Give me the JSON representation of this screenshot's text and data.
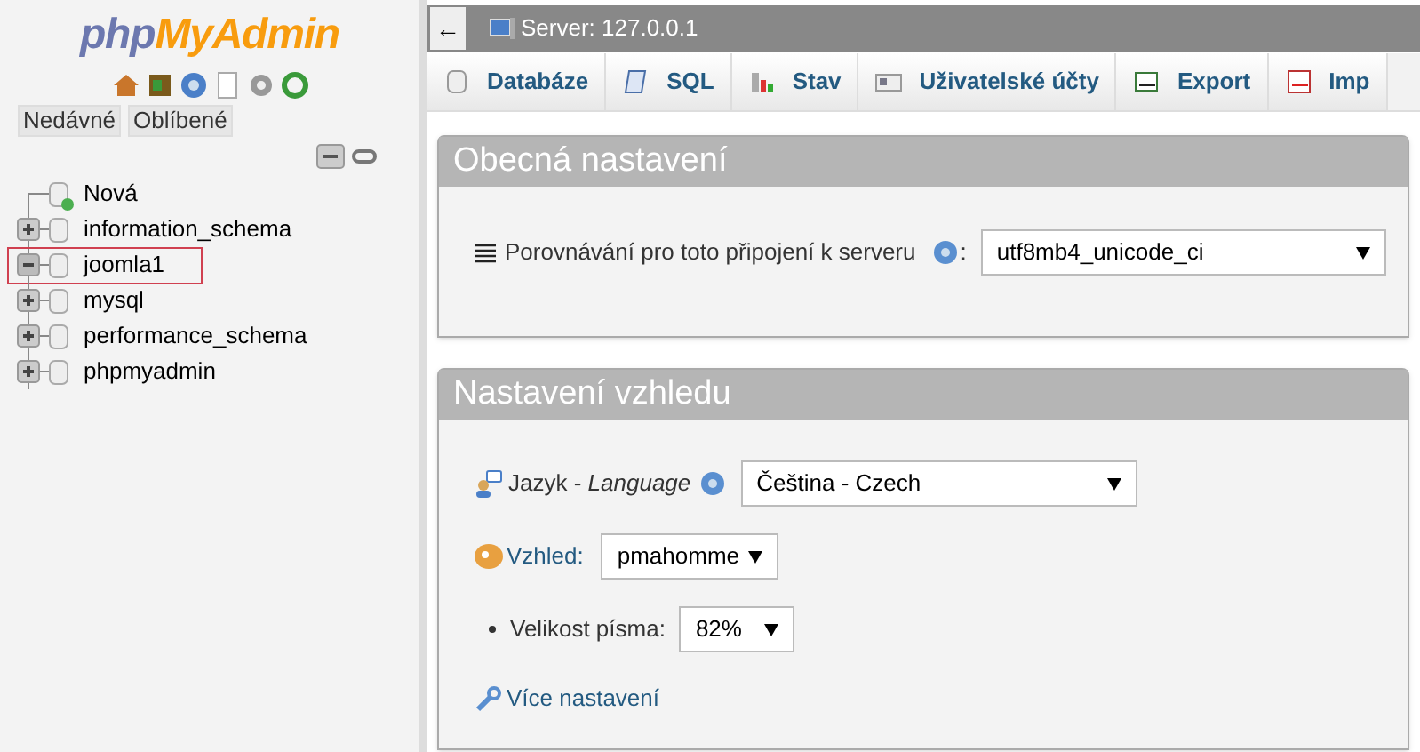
{
  "sidebar": {
    "logo": {
      "part_1": "php",
      "part_2": "MyAdmin"
    },
    "tabs": [
      {
        "label": "Nedávné"
      },
      {
        "label": "Oblíbené"
      }
    ],
    "tree": [
      {
        "kind": "new",
        "label": "Nová",
        "selected": false
      },
      {
        "kind": "database",
        "label": "information_schema",
        "expanded": false,
        "selected": false
      },
      {
        "kind": "database",
        "label": "joomla1",
        "expanded": true,
        "selected": true
      },
      {
        "kind": "database",
        "label": "mysql",
        "expanded": false,
        "selected": false
      },
      {
        "kind": "database",
        "label": "performance_schema",
        "expanded": false,
        "selected": false
      },
      {
        "kind": "database",
        "label": "phpmyadmin",
        "expanded": false,
        "selected": false
      }
    ]
  },
  "breadcrumb": {
    "back": "←",
    "server": "Server: 127.0.0.1"
  },
  "tabs": [
    {
      "kind": "db",
      "label": "Databáze"
    },
    {
      "kind": "sql",
      "label": "SQL"
    },
    {
      "kind": "status",
      "label": "Stav"
    },
    {
      "kind": "users",
      "label": "Uživatelské účty"
    },
    {
      "kind": "export",
      "label": "Export"
    },
    {
      "kind": "import",
      "label": "Imp"
    }
  ],
  "general_settings": {
    "title": "Obecná nastavení",
    "collation_label": "Porovnávání pro toto připojení k serveru",
    "colon": ":",
    "collation_value": "utf8mb4_unicode_ci"
  },
  "appearance_settings": {
    "title": "Nastavení vzhledu",
    "language_label": "Jazyk - *Language*",
    "language_value": "Čeština - Czech",
    "theme_label": "Vzhled:",
    "theme_value": "pmahomme",
    "font_size_label": "Velikost písma:",
    "font_size_value": "82%",
    "more_settings": "Více nastavení"
  }
}
